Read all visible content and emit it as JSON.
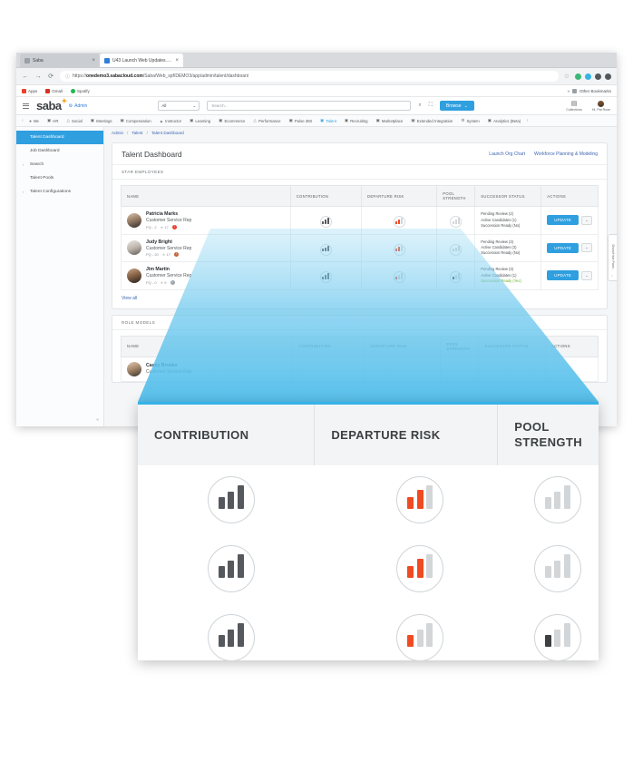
{
  "browser": {
    "tabs": [
      {
        "title": "Saba",
        "favicon": "saba-favicon",
        "active": false
      },
      {
        "title": "U43 Launch Web Updates.doc",
        "favicon": "doc-favicon",
        "active": true
      }
    ],
    "close_glyph": "×",
    "nav": {
      "back": "←",
      "forward": "→",
      "reload": "⟳"
    },
    "omnibox": {
      "lock_icon": "info-icon",
      "prefix": "https://",
      "host": "onedemo3.sabacloud.com",
      "path": "/Saba/Web_spf/DEMO3/app/admin/talent/dashboard",
      "star_icon": "bookmark-star-icon"
    },
    "bookmarks": [
      {
        "label": "Apps",
        "icon": "apps-grid-icon"
      },
      {
        "label": "Gmail",
        "icon": "gmail-icon"
      },
      {
        "label": "Spotify",
        "icon": "spotify-icon"
      }
    ],
    "bookmarks_right": {
      "label": "Other Bookmarks",
      "icon": "folder-icon",
      "overflow": "»"
    }
  },
  "app_header": {
    "menu_icon": "hamburger-icon",
    "logo_text": "saba",
    "logo_star": "✦",
    "admin_label": "Admin",
    "admin_icon": "person-gear-icon",
    "scope_select": {
      "value": "All",
      "caret": "⌄"
    },
    "search": {
      "placeholder": "Search...",
      "icon": "search-icon",
      "expand_icon": "expand-icon"
    },
    "browse_button": {
      "label": "Browse",
      "caret": "⌄"
    },
    "tiles": [
      {
        "label": "Collections",
        "icon": "collections-icon"
      },
      {
        "label": "Hi, Pat Rose",
        "icon": "avatar-icon"
      }
    ]
  },
  "nav_bar": {
    "left_arrow": "‹",
    "right_arrow": "›",
    "items": [
      {
        "label": "Me",
        "icon": "person-icon",
        "active": false
      },
      {
        "label": "HR",
        "icon": "hr-icon",
        "active": false
      },
      {
        "label": "Social",
        "icon": "social-icon",
        "active": false
      },
      {
        "label": "Meetings",
        "icon": "meetings-icon",
        "active": false
      },
      {
        "label": "Compensation",
        "icon": "compensation-icon",
        "active": false
      },
      {
        "label": "Instructor",
        "icon": "instructor-icon",
        "active": false
      },
      {
        "label": "Learning",
        "icon": "learning-icon",
        "active": false
      },
      {
        "label": "Ecommerce",
        "icon": "ecommerce-icon",
        "active": false
      },
      {
        "label": "Performance",
        "icon": "performance-icon",
        "active": false
      },
      {
        "label": "Pulse 360",
        "icon": "pulse-icon",
        "active": false
      },
      {
        "label": "Talent",
        "icon": "talent-icon",
        "active": true
      },
      {
        "label": "Recruiting",
        "icon": "recruiting-icon",
        "active": false
      },
      {
        "label": "Marketplace",
        "icon": "marketplace-icon",
        "active": false
      },
      {
        "label": "Extended Integration",
        "icon": "integration-icon",
        "active": false
      },
      {
        "label": "System",
        "icon": "gear-icon",
        "active": false
      },
      {
        "label": "Analytics (Beta)",
        "icon": "analytics-icon",
        "active": false
      }
    ]
  },
  "sidebar": {
    "items": [
      {
        "label": "Talent Dashboard",
        "active": true,
        "expandable": false
      },
      {
        "label": "Job Dashboard",
        "active": false,
        "expandable": false
      },
      {
        "label": "Search",
        "active": false,
        "expandable": true
      },
      {
        "label": "Talent Pools",
        "active": false,
        "expandable": false
      },
      {
        "label": "Talent Configurations",
        "active": false,
        "expandable": true
      }
    ],
    "caret": "›",
    "collapse_icon": "«"
  },
  "breadcrumb": {
    "items": [
      "Admin",
      "Talent",
      "Talent Dashboard"
    ],
    "separator": "/"
  },
  "page": {
    "title": "Talent Dashboard",
    "links": [
      {
        "label": "Launch Org Chart"
      },
      {
        "label": "Workforce Planning & Modeling"
      }
    ]
  },
  "sections": [
    {
      "label": "STAR EMPLOYEES"
    },
    {
      "label": "ROLE MODELS"
    }
  ],
  "table": {
    "headers": [
      "NAME",
      "CONTRIBUTION",
      "DEPARTURE RISK",
      "POOL STRENGTH",
      "SUCCESSOR STATUS",
      "ACTIONS"
    ],
    "rows": [
      {
        "name": "Patricia Marks",
        "title": "Customer Service Rep",
        "pq": "PQ - 2",
        "star_icon": "★",
        "star_count": "17",
        "badge": "!",
        "badge_color": "#e8412b",
        "contribution": {
          "bars": [
            0.5,
            0.72,
            1.0
          ],
          "colors": [
            "#55595d",
            "#55595d",
            "#55595d"
          ]
        },
        "departure_risk": {
          "bars": [
            0.5,
            0.78,
            1.0
          ],
          "colors": [
            "#f04a23",
            "#f04a23",
            "#d2d6d9"
          ]
        },
        "pool_strength": {
          "bars": [
            0.5,
            0.72,
            1.0
          ],
          "colors": [
            "#d2d6d9",
            "#d2d6d9",
            "#d2d6d9"
          ]
        },
        "successor": [
          "Pending Review (2)",
          "Active Candidates (1)",
          "Succession Ready (No)"
        ],
        "succession_ready": false,
        "update_label": "UPDATE",
        "caret": "⌄"
      },
      {
        "name": "Judy Bright",
        "title": "Customer Service Rep",
        "pq": "PQ - 20",
        "star_icon": "★",
        "star_count": "17",
        "badge": "!",
        "badge_color": "#c8623a",
        "contribution": {
          "bars": [
            0.5,
            0.72,
            1.0
          ],
          "colors": [
            "#55595d",
            "#55595d",
            "#55595d"
          ]
        },
        "departure_risk": {
          "bars": [
            0.5,
            0.78,
            1.0
          ],
          "colors": [
            "#f04a23",
            "#f04a23",
            "#d2d6d9"
          ]
        },
        "pool_strength": {
          "bars": [
            0.5,
            0.72,
            1.0
          ],
          "colors": [
            "#d2d6d9",
            "#d2d6d9",
            "#d2d6d9"
          ]
        },
        "successor": [
          "Pending Review (3)",
          "Active Candidates (3)",
          "Succession Ready (No)"
        ],
        "succession_ready": false,
        "update_label": "UPDATE",
        "caret": "⌄"
      },
      {
        "name": "Jim Martin",
        "title": "Customer Service Rep",
        "pq": "PQ - 0",
        "star_icon": "★",
        "star_count": "9",
        "badge": "i",
        "badge_color": "#9aa4ac",
        "contribution": {
          "bars": [
            0.5,
            0.72,
            1.0
          ],
          "colors": [
            "#55595d",
            "#55595d",
            "#55595d"
          ]
        },
        "departure_risk": {
          "bars": [
            0.5,
            0.78,
            1.0
          ],
          "colors": [
            "#f04a23",
            "#d2d6d9",
            "#d2d6d9"
          ]
        },
        "pool_strength": {
          "bars": [
            0.5,
            0.72,
            1.0
          ],
          "colors": [
            "#3c4043",
            "#d2d6d9",
            "#d2d6d9"
          ]
        },
        "successor": [
          "Pending Review (3)",
          "Active Candidates (1)",
          "Succession Ready (Yes)"
        ],
        "succession_ready": true,
        "update_label": "UPDATE",
        "caret": "⌄"
      }
    ],
    "view_all": "View all"
  },
  "role_models": {
    "headers": [
      "NAME",
      "CONTRIBUTION",
      "DEPARTURE RISK",
      "POOL STRENGTH",
      "SUCCESSOR STATUS",
      "ACTIONS"
    ],
    "rows": [
      {
        "name": "Casey Brooks",
        "title": "Customer Service Rep"
      }
    ]
  },
  "show_hide_tab": {
    "label": "Show/Hide Pane...",
    "arrow": "‹"
  },
  "callout": {
    "accent_color": "#35b3e8",
    "headers": [
      {
        "label": "CONTRIBUTION",
        "name": "contribution"
      },
      {
        "label": "DEPARTURE RISK",
        "name": "departure-risk"
      },
      {
        "label": "POOL STRENGTH",
        "name": "pool-strength"
      }
    ],
    "rows": [
      {
        "contribution": {
          "bars": [
            0.45,
            0.7,
            1.0
          ],
          "colors": [
            "#55595d",
            "#55595d",
            "#55595d"
          ]
        },
        "departure_risk": {
          "bars": [
            0.45,
            0.78,
            1.0
          ],
          "colors": [
            "#f04a23",
            "#f04a23",
            "#d2d6d9"
          ]
        },
        "pool_strength": {
          "bars": [
            0.45,
            0.7,
            1.0
          ],
          "colors": [
            "#d2d6d9",
            "#d2d6d9",
            "#d2d6d9"
          ]
        }
      },
      {
        "contribution": {
          "bars": [
            0.45,
            0.7,
            1.0
          ],
          "colors": [
            "#55595d",
            "#55595d",
            "#55595d"
          ]
        },
        "departure_risk": {
          "bars": [
            0.45,
            0.78,
            1.0
          ],
          "colors": [
            "#f04a23",
            "#f04a23",
            "#d2d6d9"
          ]
        },
        "pool_strength": {
          "bars": [
            0.45,
            0.7,
            1.0
          ],
          "colors": [
            "#d2d6d9",
            "#d2d6d9",
            "#d2d6d9"
          ]
        }
      },
      {
        "contribution": {
          "bars": [
            0.45,
            0.7,
            1.0
          ],
          "colors": [
            "#55595d",
            "#55595d",
            "#55595d"
          ]
        },
        "departure_risk": {
          "bars": [
            0.45,
            0.7,
            1.0
          ],
          "colors": [
            "#f04a23",
            "#d2d6d9",
            "#d2d6d9"
          ]
        },
        "pool_strength": {
          "bars": [
            0.45,
            0.7,
            1.0
          ],
          "colors": [
            "#3c4043",
            "#d2d6d9",
            "#d2d6d9"
          ]
        }
      }
    ]
  }
}
